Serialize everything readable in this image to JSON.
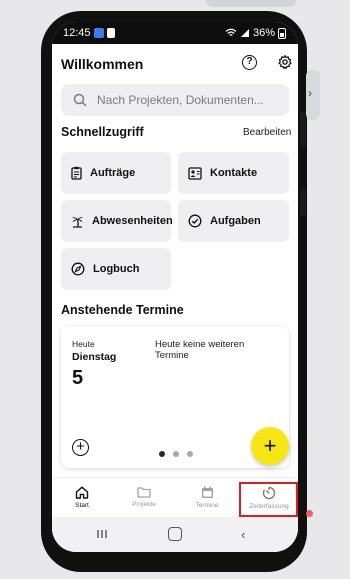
{
  "status_bar": {
    "time": "12:45",
    "battery": "36%"
  },
  "header": {
    "title": "Willkommen",
    "help_icon": "help-circle-icon",
    "settings_icon": "gear-icon"
  },
  "search": {
    "placeholder": "Nach Projekten, Dokumenten..."
  },
  "quick_access": {
    "title": "Schnellzugriff",
    "edit_label": "Bearbeiten",
    "tiles": [
      {
        "label": "Aufträge",
        "icon": "clipboard-icon"
      },
      {
        "label": "Kontakte",
        "icon": "contact-card-icon"
      },
      {
        "label": "Abwesenheiten",
        "icon": "palm-tree-icon"
      },
      {
        "label": "Aufgaben",
        "icon": "check-circle-icon"
      },
      {
        "label": "Logbuch",
        "icon": "compass-icon"
      }
    ]
  },
  "appointments": {
    "title": "Anstehende Termine",
    "today_label": "Heute",
    "weekday": "Dienstag",
    "day_number": "5",
    "message": "Heute keine weiteren Termine",
    "add_icon": "plus-circle-icon",
    "pager": {
      "count": 3,
      "active": 1
    }
  },
  "fab": {
    "label": "+",
    "color": "#f6e613"
  },
  "bottom_nav": [
    {
      "label": "Start",
      "icon": "home-icon",
      "active": true
    },
    {
      "label": "Projekte",
      "icon": "folder-icon",
      "active": false
    },
    {
      "label": "Termine",
      "icon": "calendar-icon",
      "active": false
    },
    {
      "label": "Zeiterfassung",
      "icon": "timer-icon",
      "active": false,
      "highlighted": true
    }
  ],
  "colors": {
    "highlight": "#e41b1b",
    "tile_bg": "#efeff1"
  }
}
